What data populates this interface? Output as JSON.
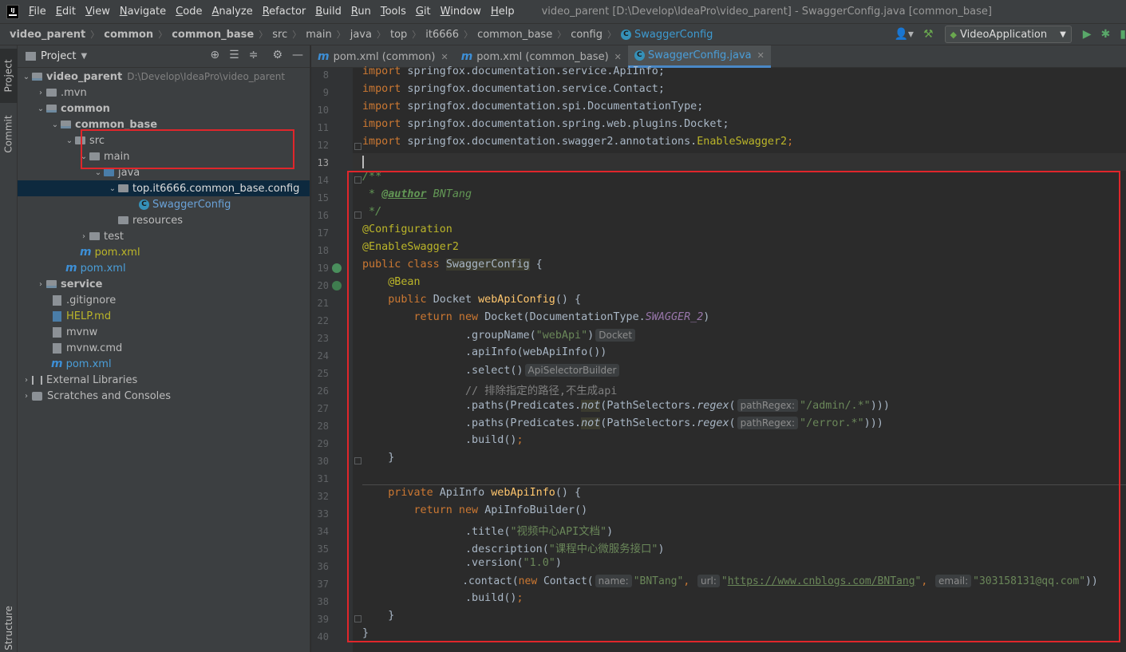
{
  "menubar": {
    "items": [
      "File",
      "Edit",
      "View",
      "Navigate",
      "Code",
      "Analyze",
      "Refactor",
      "Build",
      "Run",
      "Tools",
      "Git",
      "Window",
      "Help"
    ],
    "window_title": "video_parent [D:\\Develop\\IdeaPro\\video_parent] - SwaggerConfig.java [common_base]",
    "logo_text": "IJ"
  },
  "breadcrumbs": [
    "video_parent",
    "common",
    "common_base",
    "src",
    "main",
    "java",
    "top",
    "it6666",
    "common_base",
    "config",
    "SwaggerConfig"
  ],
  "run_config": {
    "label": "VideoApplication"
  },
  "toolstrip": {
    "project": "Project",
    "commit": "Commit",
    "structure": "Structure"
  },
  "project_panel": {
    "title": "Project",
    "tree": [
      {
        "name": "video_parent",
        "path": "D:\\Develop\\IdeaPro\\video_parent"
      },
      {
        "name": ".mvn"
      },
      {
        "name": "common"
      },
      {
        "name": "common_base"
      },
      {
        "name": "src"
      },
      {
        "name": "main"
      },
      {
        "name": "java"
      },
      {
        "name": "top.it6666.common_base.config"
      },
      {
        "name": "SwaggerConfig"
      },
      {
        "name": "resources"
      },
      {
        "name": "test"
      },
      {
        "name": "pom.xml"
      },
      {
        "name": "pom.xml"
      },
      {
        "name": "service"
      },
      {
        "name": ".gitignore"
      },
      {
        "name": "HELP.md"
      },
      {
        "name": "mvnw"
      },
      {
        "name": "mvnw.cmd"
      },
      {
        "name": "pom.xml"
      },
      {
        "name": "External Libraries"
      },
      {
        "name": "Scratches and Consoles"
      }
    ]
  },
  "editor_tabs": [
    {
      "label": "pom.xml (common)"
    },
    {
      "label": "pom.xml (common_base)"
    },
    {
      "label": "SwaggerConfig.java"
    }
  ],
  "editor": {
    "line_numbers": [
      "8",
      "9",
      "10",
      "11",
      "12",
      "13",
      "14",
      "15",
      "16",
      "17",
      "18",
      "19",
      "20",
      "21",
      "22",
      "23",
      "24",
      "25",
      "26",
      "27",
      "28",
      "29",
      "30",
      "31",
      "32",
      "33",
      "34",
      "35",
      "36",
      "37",
      "38",
      "39",
      "40"
    ],
    "code": {
      "import_kw": "import",
      "imp8": " springfox.documentation.service.ApiInfo;",
      "imp9": " springfox.documentation.service.Contact;",
      "imp10": " springfox.documentation.spi.DocumentationType;",
      "imp11": " springfox.documentation.spring.web.plugins.Docket;",
      "imp12a": " springfox.documentation.swagger2.annotations.",
      "imp12b": "EnableSwagger2",
      "semi": ";",
      "doc_open": "/**",
      "doc_star": " * ",
      "doc_author_tag": "@author",
      "doc_author": " BNTang",
      "doc_close": " */",
      "ann_config": "@Configuration",
      "ann_swagger": "@EnableSwagger2",
      "public_class": "public class ",
      "class_name": "SwaggerConfig",
      "brace_open": " {",
      "ann_bean": "    @Bean",
      "l21_kw": "    public ",
      "l21_type": "Docket ",
      "l21_meth": "webApiConfig",
      "l21_rest": "() {",
      "l22_kw": "        return new ",
      "l22_rest": "Docket(DocumentationType.",
      "l22_static": "SWAGGER_2",
      "close_paren": ")",
      "l23_pre": "                .groupName(",
      "l23_str": "\"webApi\"",
      "l23_post": ")",
      "hint_docket": "Docket",
      "l24": "                .apiInfo(webApiInfo())",
      "l25": "                .select()",
      "hint_api_selector": "ApiSelectorBuilder",
      "l26": "                // 排除指定的路径,不生成api",
      "l27_pre": "                .paths(Predicates.",
      "not": "not",
      "l27_mid": "(PathSelectors.",
      "regex": "regex",
      "open_paren": "(",
      "hint_path_regex": "pathRegex:",
      "l27_str": "\"/admin/.*\"",
      "l28_str": "\"/error.*\"",
      "triple_close": ")))",
      "l29_pre": "                .build()",
      "l30": "    }",
      "l32_kw": "    private ",
      "l32_type": "ApiInfo ",
      "l32_meth": "webApiInfo",
      "l32_rest": "() {",
      "l33_kw": "        return new ",
      "l33_rest": "ApiInfoBuilder()",
      "l34_pre": "                .title(",
      "l34_str": "\"视频中心API文档\"",
      "l35_pre": "                .description(",
      "l35_str": "\"课程中心微服务接口\"",
      "l36_pre": "                .version(",
      "l36_str": "\"1.0\"",
      "l37_pre": "                .contact(",
      "l37_kw": "new ",
      "l37_cls": "Contact(",
      "hint_name": "name:",
      "l37_name": "\"BNTang\"",
      "comma": ", ",
      "hint_url": "url:",
      "l37_url_q": "\"",
      "l37_url": "https://www.cnblogs.com/BNTang",
      "hint_email": "email:",
      "l37_email": "\"303158131@qq.com\"",
      "double_close": "))",
      "l38_pre": "                .build()",
      "l39": "    }",
      "l40": "}"
    }
  },
  "colors": {
    "highlight_box": "#e0262b",
    "keyword": "#cc7832",
    "annotation": "#bbb529",
    "string": "#6a8759",
    "method": "#ffc66d"
  }
}
